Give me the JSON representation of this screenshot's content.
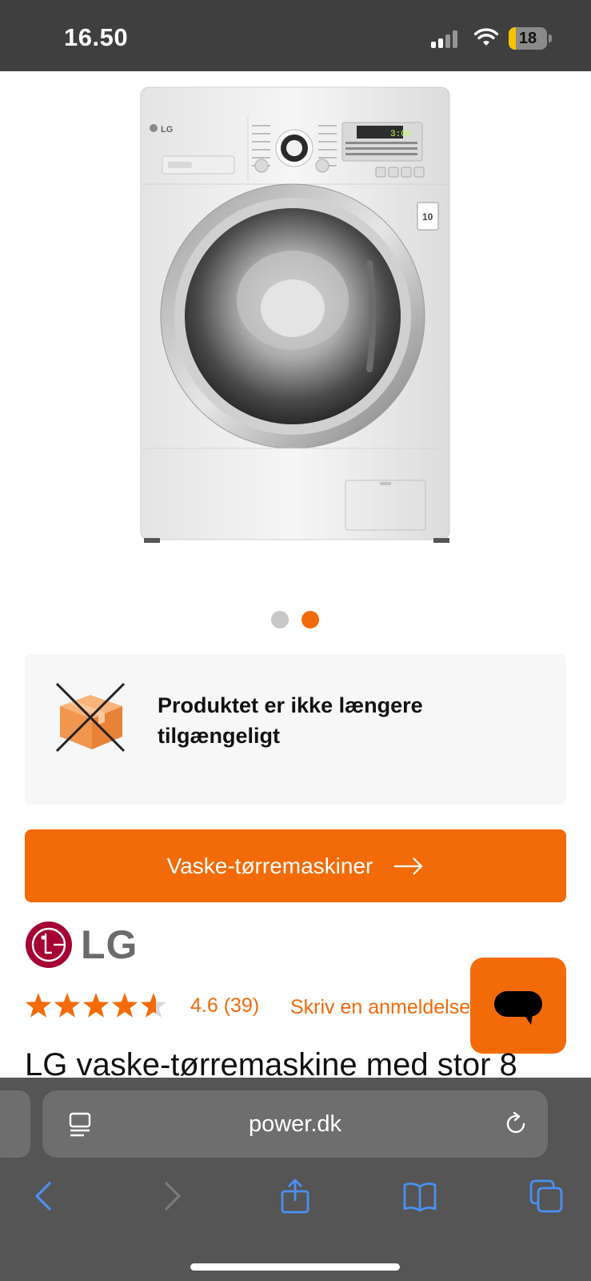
{
  "status_bar": {
    "time": "16.50",
    "battery_level": "18",
    "battery_fraction": 0.18
  },
  "product": {
    "image_alt": "LG washer-dryer front view",
    "carousel": {
      "count": 2,
      "active_index": 1
    },
    "unavailable_notice": "Produktet er ikke længere tilgængeligt",
    "category_button_label": "Vaske-tørremaskiner",
    "brand": "LG",
    "rating": {
      "stars": 4.6,
      "label": "4.6 (39)",
      "review_link": "Skriv en anmeldelse"
    },
    "title": "LG vaske-tørremaskine med stor 8"
  },
  "browser": {
    "url": "power.dk",
    "toolbar_icons": [
      "back-icon",
      "forward-icon",
      "share-icon",
      "bookmarks-icon",
      "tabs-icon"
    ]
  },
  "colors": {
    "accent": "#f36b08",
    "status_bar_bg": "#3f3f3f",
    "browser_bg": "#555555",
    "ios_blue": "#4a90f0",
    "lg_red": "#a50034"
  }
}
